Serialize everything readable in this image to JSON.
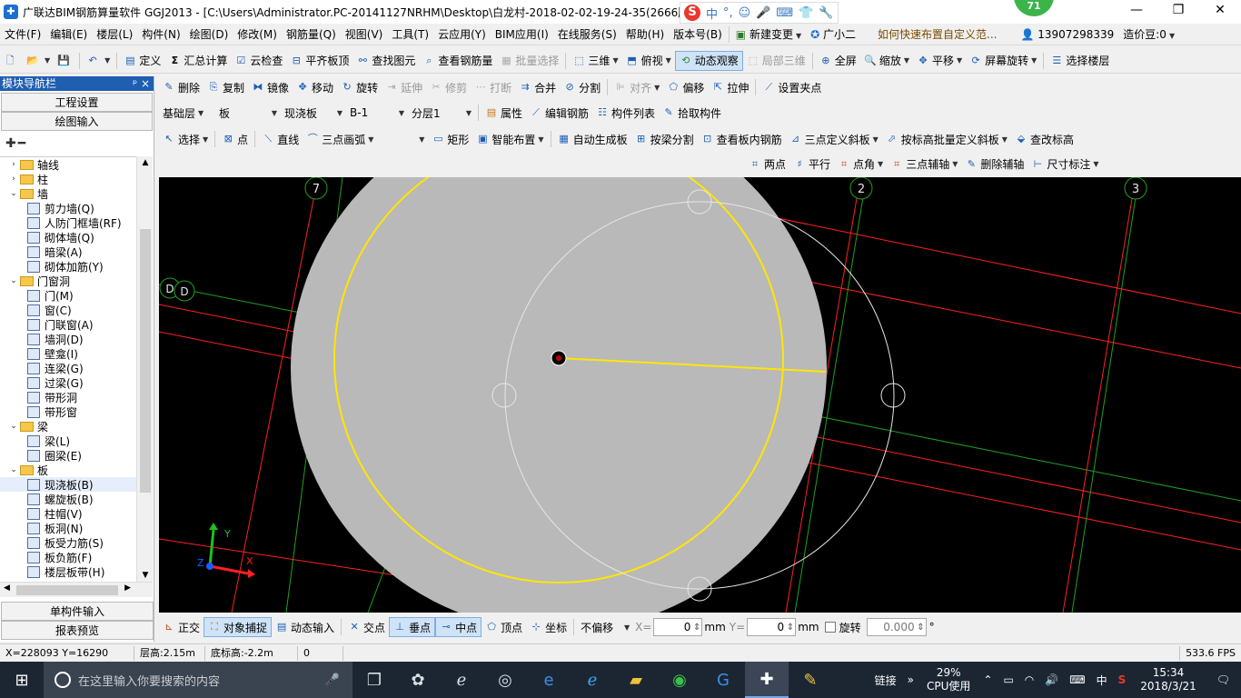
{
  "window": {
    "title": "广联达BIM钢筋算量软件 GGJ2013 - [C:\\Users\\Administrator.PC-20141127NRHM\\Desktop\\白龙村-2018-02-02-19-24-35(2666版",
    "badge": "71",
    "ime": [
      "中",
      "°,",
      "☺",
      "🎤",
      "⌨",
      "👕",
      "🔧"
    ]
  },
  "menu": {
    "items": [
      "文件(F)",
      "编辑(E)",
      "楼层(L)",
      "构件(N)",
      "绘图(D)",
      "修改(M)",
      "钢筋量(Q)",
      "视图(V)",
      "工具(T)",
      "云应用(Y)",
      "BIM应用(I)",
      "在线服务(S)",
      "帮助(H)",
      "版本号(B)"
    ],
    "new_change": "新建变更",
    "assistant": "广小二",
    "help_link": "如何快速布置自定义范...",
    "phone": "13907298339",
    "coins": "造价豆:0"
  },
  "toolbar1": {
    "define": "定义",
    "sum": "汇总计算",
    "cloud_check": "云检查",
    "flush_slab": "平齐板顶",
    "find_element": "查找图元",
    "view_rebar": "查看钢筋量",
    "batch_select": "批量选择",
    "three_d": "三维",
    "top_view": "俯视",
    "dynamic_view": "动态观察",
    "local_3d": "局部三维",
    "fullscreen": "全屏",
    "zoom": "缩放",
    "pan": "平移",
    "rotate_screen": "屏幕旋转",
    "select_floor": "选择楼层"
  },
  "toolbar2": {
    "delete": "删除",
    "copy": "复制",
    "mirror": "镜像",
    "move": "移动",
    "rotate": "旋转",
    "extend": "延伸",
    "trim": "修剪",
    "break": "打断",
    "merge": "合并",
    "split": "分割",
    "align": "对齐",
    "offset": "偏移",
    "stretch": "拉伸",
    "set_grip": "设置夹点"
  },
  "toolbar3": {
    "floor": "基础层",
    "category": "板",
    "type": "现浇板",
    "element": "B-1",
    "layer": "分层1",
    "properties": "属性",
    "edit_rebar": "编辑钢筋",
    "element_list": "构件列表",
    "pick_element": "拾取构件"
  },
  "toolbar4": {
    "select": "选择",
    "point": "点",
    "line": "直线",
    "arc3": "三点画弧",
    "rect": "矩形",
    "smart_layout": "智能布置",
    "auto_slab": "自动生成板",
    "split_by_beam": "按梁分割",
    "view_slab_rebar": "查看板内钢筋",
    "three_point_slope": "三点定义斜板",
    "batch_slope": "按标高批量定义斜板",
    "edit_elevation": "查改标高"
  },
  "toolbar5": {
    "two_points": "两点",
    "parallel": "平行",
    "point_angle": "点角",
    "three_point_axis": "三点辅轴",
    "delete_axis": "删除辅轴",
    "dimension": "尺寸标注"
  },
  "nav": {
    "header": "模块导航栏",
    "pin": "ᵖ ×",
    "project_settings": "工程设置",
    "drawing_input": "绘图输入",
    "single_input": "单构件输入",
    "report_preview": "报表预览",
    "tree": [
      {
        "label": "轴线",
        "kind": "folder",
        "state": "collapsed",
        "level": 0
      },
      {
        "label": "柱",
        "kind": "folder",
        "state": "collapsed",
        "level": 0
      },
      {
        "label": "墙",
        "kind": "folder",
        "state": "expanded",
        "level": 0
      },
      {
        "label": "剪力墙(Q)",
        "kind": "leaf",
        "level": 1
      },
      {
        "label": "人防门框墙(RF)",
        "kind": "leaf",
        "level": 1
      },
      {
        "label": "砌体墙(Q)",
        "kind": "leaf",
        "level": 1
      },
      {
        "label": "暗梁(A)",
        "kind": "leaf",
        "level": 1
      },
      {
        "label": "砌体加筋(Y)",
        "kind": "leaf",
        "level": 1
      },
      {
        "label": "门窗洞",
        "kind": "folder",
        "state": "expanded",
        "level": 0
      },
      {
        "label": "门(M)",
        "kind": "leaf",
        "level": 1
      },
      {
        "label": "窗(C)",
        "kind": "leaf",
        "level": 1
      },
      {
        "label": "门联窗(A)",
        "kind": "leaf",
        "level": 1
      },
      {
        "label": "墙洞(D)",
        "kind": "leaf",
        "level": 1
      },
      {
        "label": "壁龛(I)",
        "kind": "leaf",
        "level": 1
      },
      {
        "label": "连梁(G)",
        "kind": "leaf",
        "level": 1
      },
      {
        "label": "过梁(G)",
        "kind": "leaf",
        "level": 1
      },
      {
        "label": "带形洞",
        "kind": "leaf",
        "level": 1
      },
      {
        "label": "带形窗",
        "kind": "leaf",
        "level": 1
      },
      {
        "label": "梁",
        "kind": "folder",
        "state": "expanded",
        "level": 0
      },
      {
        "label": "梁(L)",
        "kind": "leaf",
        "level": 1
      },
      {
        "label": "圈梁(E)",
        "kind": "leaf",
        "level": 1
      },
      {
        "label": "板",
        "kind": "folder",
        "state": "expanded",
        "level": 0
      },
      {
        "label": "现浇板(B)",
        "kind": "leaf",
        "level": 1,
        "selected": true
      },
      {
        "label": "螺旋板(B)",
        "kind": "leaf",
        "level": 1
      },
      {
        "label": "柱帽(V)",
        "kind": "leaf",
        "level": 1
      },
      {
        "label": "板洞(N)",
        "kind": "leaf",
        "level": 1
      },
      {
        "label": "板受力筋(S)",
        "kind": "leaf",
        "level": 1
      },
      {
        "label": "板负筋(F)",
        "kind": "leaf",
        "level": 1
      },
      {
        "label": "楼层板带(H)",
        "kind": "leaf",
        "level": 1
      }
    ]
  },
  "canvas": {
    "axis_labels": [
      "7",
      "2",
      "3",
      "D",
      "D"
    ],
    "ucs": {
      "x": "X",
      "y": "Y",
      "z": "Z"
    }
  },
  "snapbar": {
    "ortho": "正交",
    "object_snap": "对象捕捉",
    "dynamic_input": "动态输入",
    "intersection": "交点",
    "perpendicular": "垂点",
    "midpoint": "中点",
    "vertex": "顶点",
    "coordinate": "坐标",
    "offset_mode": "不偏移",
    "x_label": "X=",
    "x_value": "0",
    "y_label": "Y=",
    "y_value": "0",
    "unit": "mm",
    "rotate_label": "旋转",
    "rotate_value": "0.000",
    "degree": "°"
  },
  "status": {
    "coords": "X=228093 Y=16290",
    "floor_height": "层高:2.15m",
    "bottom_height": "底标高:-2.2m",
    "value": "0",
    "fps": "533.6 FPS"
  },
  "taskbar": {
    "search_placeholder": "在这里输入你要搜索的内容",
    "link": "链接",
    "cpu_percent": "29%",
    "cpu_label": "CPU使用",
    "ime": "中",
    "time": "15:34",
    "date": "2018/3/21"
  },
  "colors": {
    "nav_header": "#1f5eb0",
    "canvas_bg": "#000000",
    "slab_fill": "#b8b8b8",
    "yellow": "#ffe600",
    "red_axis": "#ff2020",
    "green_axis": "#20a020",
    "taskbar": "#1c2633"
  }
}
